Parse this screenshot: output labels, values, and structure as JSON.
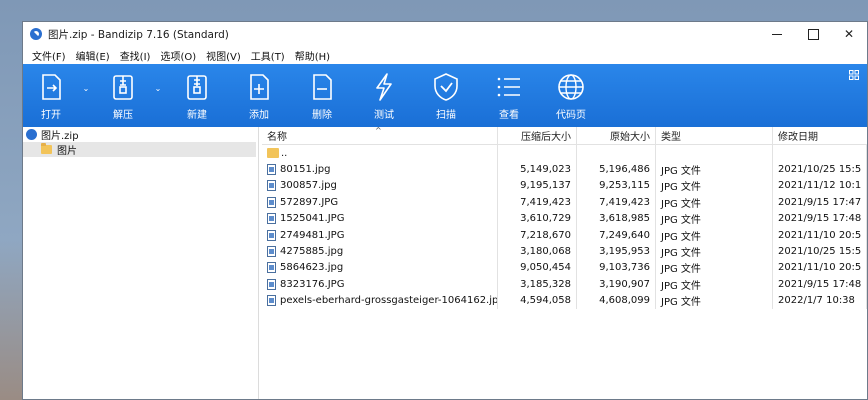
{
  "window": {
    "title": "图片.zip - Bandizip 7.16 (Standard)"
  },
  "menu": [
    "文件(F)",
    "编辑(E)",
    "查找(I)",
    "选项(O)",
    "视图(V)",
    "工具(T)",
    "帮助(H)"
  ],
  "toolbar": {
    "open": "打开",
    "extract": "解压",
    "new": "新建",
    "add": "添加",
    "delete": "删除",
    "test": "测试",
    "scan": "扫描",
    "view": "查看",
    "codepage": "代码页"
  },
  "tree": {
    "root": "图片.zip",
    "child": "图片"
  },
  "columns": {
    "name": "名称",
    "compressed": "压缩后大小",
    "original": "原始大小",
    "type": "类型",
    "modified": "修改日期"
  },
  "updir": "..",
  "files": [
    {
      "name": "80151.jpg",
      "compressed": "5,149,023",
      "original": "5,196,486",
      "type": "JPG 文件",
      "modified": "2021/10/25 15:5"
    },
    {
      "name": "300857.jpg",
      "compressed": "9,195,137",
      "original": "9,253,115",
      "type": "JPG 文件",
      "modified": "2021/11/12 10:1"
    },
    {
      "name": "572897.JPG",
      "compressed": "7,419,423",
      "original": "7,419,423",
      "type": "JPG 文件",
      "modified": "2021/9/15 17:47"
    },
    {
      "name": "1525041.JPG",
      "compressed": "3,610,729",
      "original": "3,618,985",
      "type": "JPG 文件",
      "modified": "2021/9/15 17:48"
    },
    {
      "name": "2749481.JPG",
      "compressed": "7,218,670",
      "original": "7,249,640",
      "type": "JPG 文件",
      "modified": "2021/11/10 20:5"
    },
    {
      "name": "4275885.jpg",
      "compressed": "3,180,068",
      "original": "3,195,953",
      "type": "JPG 文件",
      "modified": "2021/10/25 15:5"
    },
    {
      "name": "5864623.jpg",
      "compressed": "9,050,454",
      "original": "9,103,736",
      "type": "JPG 文件",
      "modified": "2021/11/10 20:5"
    },
    {
      "name": "8323176.JPG",
      "compressed": "3,185,328",
      "original": "3,190,907",
      "type": "JPG 文件",
      "modified": "2021/9/15 17:48"
    },
    {
      "name": "pexels-eberhard-grossgasteiger-1064162.jpg",
      "compressed": "4,594,058",
      "original": "4,608,099",
      "type": "JPG 文件",
      "modified": "2022/1/7 10:38"
    }
  ]
}
